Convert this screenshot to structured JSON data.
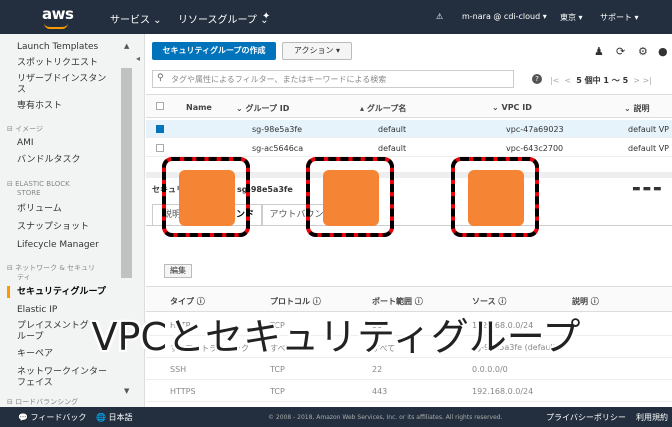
{
  "topnav": {
    "logo": "aws",
    "services": "サービス ⌄",
    "resource_groups": "リソースグループ ⌄",
    "pin": "✦",
    "bell": "🔔",
    "account": "m-nara @ cdi-cloud ▾",
    "region": "東京 ▾",
    "support": "サポート ▾"
  },
  "sidebar": {
    "items": [
      "Launch Templates",
      "スポットリクエスト",
      "リザーブドインスタン",
      "ス",
      "専有ホスト"
    ],
    "section_images": "イメージ",
    "images_items": [
      "AMI",
      "バンドルタスク"
    ],
    "section_ebs": "ELASTIC BLOCK",
    "section_ebs2": "STORE",
    "ebs_items": [
      "ボリューム",
      "スナップショット",
      "Lifecycle Manager"
    ],
    "section_network": "ネットワーク & セキュリ",
    "section_network2": "ティ",
    "network_items": [
      "セキュリティグループ",
      "Elastic IP",
      "プレイスメントグ",
      "ループ",
      "キーペア",
      "ネットワークインター",
      "フェイス"
    ],
    "section_lb": "ロードバランシング"
  },
  "toolbar": {
    "create_label": "セキュリティグループの作成",
    "action_label": "アクション ▾"
  },
  "search": {
    "placeholder": "タグや属性によるフィルター、またはキーワードによる検索",
    "pager": "5 個中 1 ～ 5"
  },
  "grid": {
    "headers": [
      "Name",
      "グループ ID",
      "グループ名",
      "VPC ID",
      "説明"
    ],
    "rows": [
      {
        "id": "sg-98e5a3fe",
        "name": "default",
        "vpc": "vpc-47a69023",
        "desc": "default VP"
      },
      {
        "id": "sg-ac5646ca",
        "name": "default",
        "vpc": "vpc-643c2700",
        "desc": "default VP"
      }
    ]
  },
  "detail": {
    "title": "セキュリティグループ: sg-98e5a3fe",
    "tabs": [
      "説明",
      "インバウンド",
      "アウトバウンド"
    ],
    "edit_label": "編集"
  },
  "rules": {
    "headers": [
      "タイプ ⓘ",
      "プロトコル ⓘ",
      "ポート範囲 ⓘ",
      "ソース ⓘ",
      "説明 ⓘ"
    ],
    "rows": [
      [
        "HTTP",
        "TCP",
        "80",
        "192.168.0.0/24"
      ],
      [
        "すべてのトラフィック",
        "すべて",
        "すべて",
        "sg-98e5a3fe (default)"
      ],
      [
        "SSH",
        "TCP",
        "22",
        "0.0.0.0/0"
      ],
      [
        "HTTPS",
        "TCP",
        "443",
        "192.168.0.0/24"
      ]
    ]
  },
  "footer": {
    "feedback": "フィードバック",
    "language": "日本語",
    "copyright": "© 2008 - 2018, Amazon Web Services, Inc. or its affiliates. All rights reserved.",
    "privacy": "プライバシーポリシー",
    "terms": "利用規約"
  },
  "caption": "VPCとセキュリティグループ",
  "colors": {
    "nav_bg": "#232f3e",
    "accent_orange": "#f58534",
    "primary_blue": "#0073bb",
    "frame_red": "#e8000b"
  }
}
